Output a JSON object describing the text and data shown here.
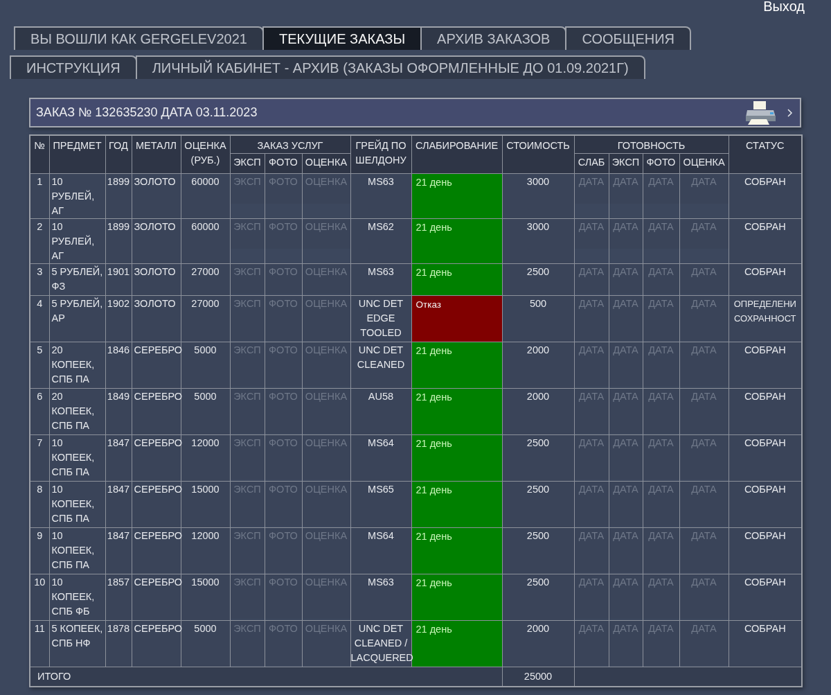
{
  "exit_link": "Выход",
  "tab_rows": [
    {
      "tabs": [
        {
          "label": "ВЫ ВОШЛИ КАК GERGELEV2021",
          "selected": false
        },
        {
          "label": "ТЕКУЩИЕ ЗАКАЗЫ",
          "selected": true
        },
        {
          "label": "АРХИВ ЗАКАЗОВ",
          "selected": false
        },
        {
          "label": "СООБЩЕНИЯ",
          "selected": false
        }
      ]
    },
    {
      "tabs": [
        {
          "label": "ИНСТРУКЦИЯ",
          "selected": false
        },
        {
          "label": "ЛИЧНЫЙ КАБИНЕТ - АРХИВ (ЗАКАЗЫ ОФОРМЛЕННЫЕ ДО 01.09.2021Г)",
          "selected": false
        }
      ]
    }
  ],
  "order": {
    "title": "ЗАКАЗ № 132635230 ДАТА 03.11.2023",
    "table": {
      "columns": [
        {
          "label": "№"
        },
        {
          "label": "ПРЕДМЕТ"
        },
        {
          "label": "ГОД"
        },
        {
          "label": "МЕТАЛЛ"
        },
        {
          "label": "ОЦЕНКА (РУБ.)"
        },
        {
          "label": "ЗАКАЗ УСЛУГ",
          "children": [
            {
              "label": "ЭКСП"
            },
            {
              "label": "ФОТО"
            },
            {
              "label": "ОЦЕНКА"
            }
          ]
        },
        {
          "label": "ГРЕЙД ПО ШЕЛДОНУ"
        },
        {
          "label": "СЛАБИРОВАНИЕ"
        },
        {
          "label": "СТОИМОСТЬ"
        },
        {
          "label": "ГОТОВНОСТЬ",
          "children": [
            {
              "label": "СЛАБ"
            },
            {
              "label": "ЭКСП"
            },
            {
              "label": "ФОТО"
            },
            {
              "label": "ОЦЕНКА"
            }
          ]
        },
        {
          "label": "СТАТУС"
        }
      ],
      "rows": [
        {
          "no": "1",
          "item": "10 РУБЛЕЙ, АГ",
          "year": "1899",
          "metal": "ЗОЛОТО",
          "estimate": "60000",
          "services": [
            {
              "placeholder": "ЭКСП"
            },
            {
              "placeholder": "ФОТО"
            },
            {
              "placeholder": "ОЦЕНКА"
            }
          ],
          "grade": "MS63",
          "slab": {
            "text": "21 день",
            "color": "#008000"
          },
          "cost": "3000",
          "readiness": [
            {
              "placeholder": "ДАТА"
            },
            {
              "placeholder": "ДАТА"
            },
            {
              "placeholder": "ДАТА"
            },
            {
              "placeholder": "ДАТА"
            }
          ],
          "status": "СОБРАН"
        },
        {
          "no": "2",
          "item": "10 РУБЛЕЙ, АГ",
          "year": "1899",
          "metal": "ЗОЛОТО",
          "estimate": "60000",
          "services": [
            {
              "placeholder": "ЭКСП"
            },
            {
              "placeholder": "ФОТО"
            },
            {
              "placeholder": "ОЦЕНКА"
            }
          ],
          "grade": "MS62",
          "slab": {
            "text": "21 день",
            "color": "#008000"
          },
          "cost": "3000",
          "readiness": [
            {
              "placeholder": "ДАТА"
            },
            {
              "placeholder": "ДАТА"
            },
            {
              "placeholder": "ДАТА"
            },
            {
              "placeholder": "ДАТА"
            }
          ],
          "status": "СОБРАН"
        },
        {
          "no": "3",
          "item": "5 РУБЛЕЙ, ФЗ",
          "year": "1901",
          "metal": "ЗОЛОТО",
          "estimate": "27000",
          "services": [
            {
              "placeholder": "ЭКСП"
            },
            {
              "placeholder": "ФОТО"
            },
            {
              "placeholder": "ОЦЕНКА"
            }
          ],
          "grade": "MS63",
          "slab": {
            "text": "21 день",
            "color": "#008000"
          },
          "cost": "2500",
          "readiness": [
            {
              "placeholder": "ДАТА"
            },
            {
              "placeholder": "ДАТА"
            },
            {
              "placeholder": "ДАТА"
            },
            {
              "placeholder": "ДАТА"
            }
          ],
          "status": "СОБРАН"
        },
        {
          "no": "4",
          "item": "5 РУБЛЕЙ, АР",
          "year": "1902",
          "metal": "ЗОЛОТО",
          "estimate": "27000",
          "services": [
            {
              "placeholder": "ЭКСП"
            },
            {
              "placeholder": "ФОТО"
            },
            {
              "placeholder": "ОЦЕНКА"
            }
          ],
          "grade": "UNC DET EDGE TOOLED",
          "slab": {
            "text": "Отказ",
            "color": "#800000"
          },
          "cost": "500",
          "readiness": [
            {
              "placeholder": "ДАТА"
            },
            {
              "placeholder": "ДАТА"
            },
            {
              "placeholder": "ДАТА"
            },
            {
              "placeholder": "ДАТА"
            }
          ],
          "status": "ОПРЕДЕЛЕНИ СОХРАННОСТ"
        },
        {
          "no": "5",
          "item": "20 КОПЕЕК, СПБ ПА",
          "year": "1846",
          "metal": "СЕРЕБРО",
          "estimate": "5000",
          "services": [
            {
              "placeholder": "ЭКСП"
            },
            {
              "placeholder": "ФОТО"
            },
            {
              "placeholder": "ОЦЕНКА"
            }
          ],
          "grade": "UNC DET CLEANED",
          "slab": {
            "text": "21 день",
            "color": "#008000"
          },
          "cost": "2000",
          "readiness": [
            {
              "placeholder": "ДАТА"
            },
            {
              "placeholder": "ДАТА"
            },
            {
              "placeholder": "ДАТА"
            },
            {
              "placeholder": "ДАТА"
            }
          ],
          "status": "СОБРАН"
        },
        {
          "no": "6",
          "item": "20 КОПЕЕК, СПБ ПА",
          "year": "1849",
          "metal": "СЕРЕБРО",
          "estimate": "5000",
          "services": [
            {
              "placeholder": "ЭКСП"
            },
            {
              "placeholder": "ФОТО"
            },
            {
              "placeholder": "ОЦЕНКА"
            }
          ],
          "grade": "AU58",
          "slab": {
            "text": "21 день",
            "color": "#008000"
          },
          "cost": "2000",
          "readiness": [
            {
              "placeholder": "ДАТА"
            },
            {
              "placeholder": "ДАТА"
            },
            {
              "placeholder": "ДАТА"
            },
            {
              "placeholder": "ДАТА"
            }
          ],
          "status": "СОБРАН"
        },
        {
          "no": "7",
          "item": "10 КОПЕЕК, СПБ ПА",
          "year": "1847",
          "metal": "СЕРЕБРО",
          "estimate": "12000",
          "services": [
            {
              "placeholder": "ЭКСП"
            },
            {
              "placeholder": "ФОТО"
            },
            {
              "placeholder": "ОЦЕНКА"
            }
          ],
          "grade": "MS64",
          "slab": {
            "text": "21 день",
            "color": "#008000"
          },
          "cost": "2500",
          "readiness": [
            {
              "placeholder": "ДАТА"
            },
            {
              "placeholder": "ДАТА"
            },
            {
              "placeholder": "ДАТА"
            },
            {
              "placeholder": "ДАТА"
            }
          ],
          "status": "СОБРАН"
        },
        {
          "no": "8",
          "item": "10 КОПЕЕК, СПБ ПА",
          "year": "1847",
          "metal": "СЕРЕБРО",
          "estimate": "15000",
          "services": [
            {
              "placeholder": "ЭКСП"
            },
            {
              "placeholder": "ФОТО"
            },
            {
              "placeholder": "ОЦЕНКА"
            }
          ],
          "grade": "MS65",
          "slab": {
            "text": "21 день",
            "color": "#008000"
          },
          "cost": "2500",
          "readiness": [
            {
              "placeholder": "ДАТА"
            },
            {
              "placeholder": "ДАТА"
            },
            {
              "placeholder": "ДАТА"
            },
            {
              "placeholder": "ДАТА"
            }
          ],
          "status": "СОБРАН"
        },
        {
          "no": "9",
          "item": "10 КОПЕЕК, СПБ ПА",
          "year": "1847",
          "metal": "СЕРЕБРО",
          "estimate": "12000",
          "services": [
            {
              "placeholder": "ЭКСП"
            },
            {
              "placeholder": "ФОТО"
            },
            {
              "placeholder": "ОЦЕНКА"
            }
          ],
          "grade": "MS64",
          "slab": {
            "text": "21 день",
            "color": "#008000"
          },
          "cost": "2500",
          "readiness": [
            {
              "placeholder": "ДАТА"
            },
            {
              "placeholder": "ДАТА"
            },
            {
              "placeholder": "ДАТА"
            },
            {
              "placeholder": "ДАТА"
            }
          ],
          "status": "СОБРАН"
        },
        {
          "no": "10",
          "item": "10 КОПЕЕК, СПБ ФБ",
          "year": "1857",
          "metal": "СЕРЕБРО",
          "estimate": "15000",
          "services": [
            {
              "placeholder": "ЭКСП"
            },
            {
              "placeholder": "ФОТО"
            },
            {
              "placeholder": "ОЦЕНКА"
            }
          ],
          "grade": "MS63",
          "slab": {
            "text": "21 день",
            "color": "#008000"
          },
          "cost": "2500",
          "readiness": [
            {
              "placeholder": "ДАТА"
            },
            {
              "placeholder": "ДАТА"
            },
            {
              "placeholder": "ДАТА"
            },
            {
              "placeholder": "ДАТА"
            }
          ],
          "status": "СОБРАН"
        },
        {
          "no": "11",
          "item": "5 КОПЕЕК, СПБ НФ",
          "year": "1878",
          "metal": "СЕРЕБРО",
          "estimate": "5000",
          "services": [
            {
              "placeholder": "ЭКСП"
            },
            {
              "placeholder": "ФОТО"
            },
            {
              "placeholder": "ОЦЕНКА"
            }
          ],
          "grade": "UNC DET CLEANED / LACQUERED",
          "slab": {
            "text": "21 день",
            "color": "#008000"
          },
          "cost": "2000",
          "readiness": [
            {
              "placeholder": "ДАТА"
            },
            {
              "placeholder": "ДАТА"
            },
            {
              "placeholder": "ДАТА"
            },
            {
              "placeholder": "ДАТА"
            }
          ],
          "status": "СОБРАН"
        }
      ],
      "total": {
        "label": "ИТОГО",
        "value": "25000"
      }
    }
  }
}
